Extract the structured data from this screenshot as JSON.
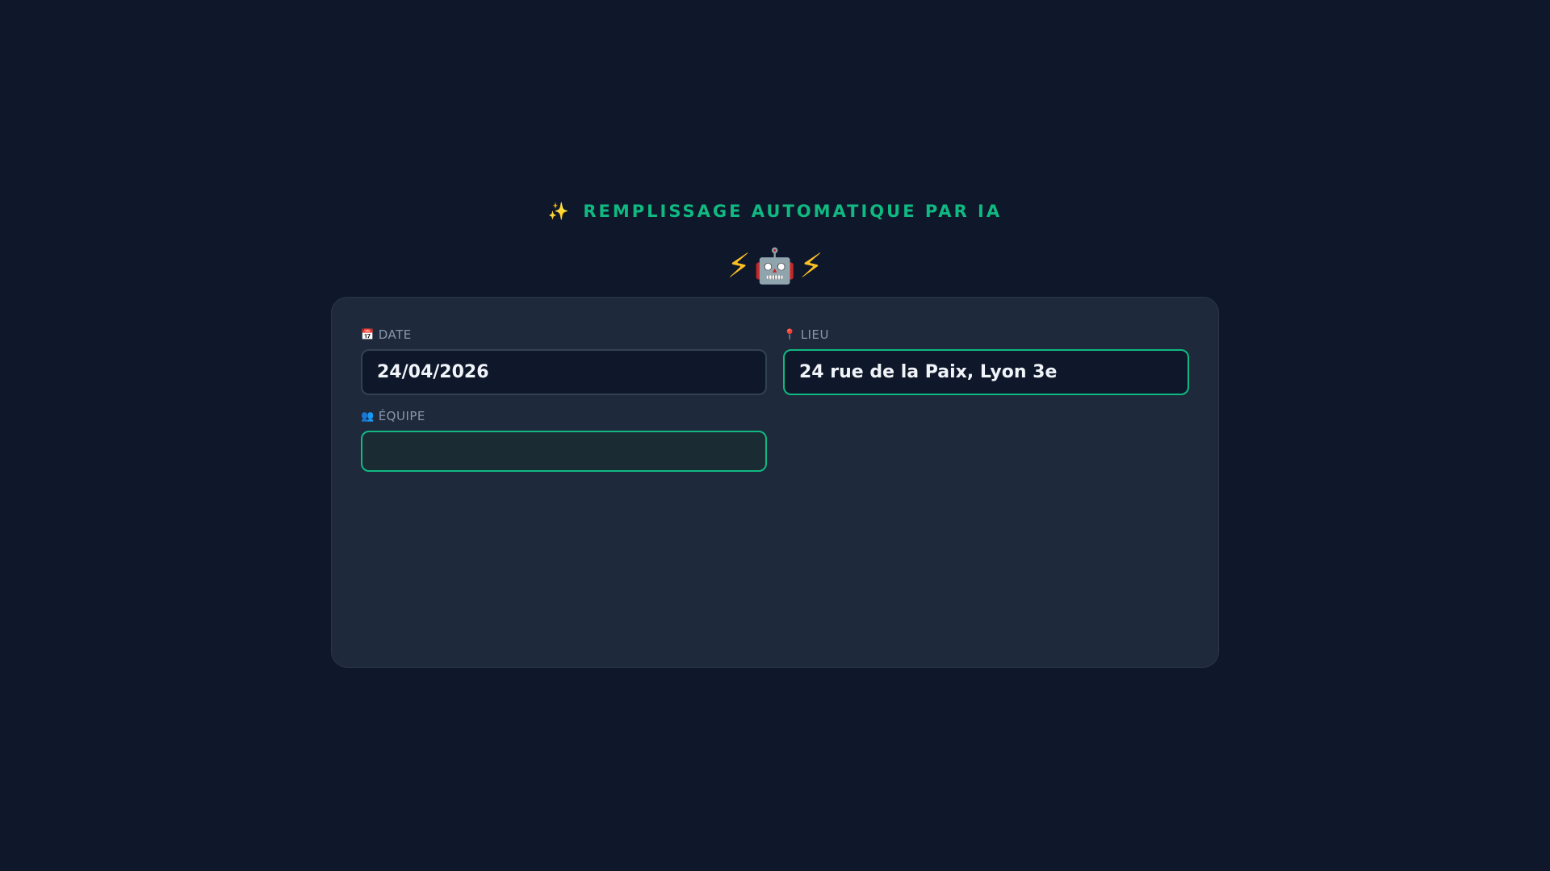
{
  "banner": {
    "sparkle_icon": "✨",
    "text": "REMPLISSAGE AUTOMATIQUE PAR IA"
  },
  "mascot": {
    "left_icon": "⚡",
    "center_icon": "🤖",
    "right_icon": "⚡"
  },
  "form": {
    "date": {
      "icon": "📅",
      "label": "DATE",
      "value": "24/04/2026"
    },
    "lieu": {
      "icon": "📍",
      "label": "LIEU",
      "value": "24 rue de la Paix, Lyon 3e"
    },
    "equipe": {
      "icon": "👥",
      "label": "ÉQUIPE",
      "value": ""
    }
  },
  "colors": {
    "background": "#0f172a",
    "card": "#1e293b",
    "accent": "#10b981"
  }
}
